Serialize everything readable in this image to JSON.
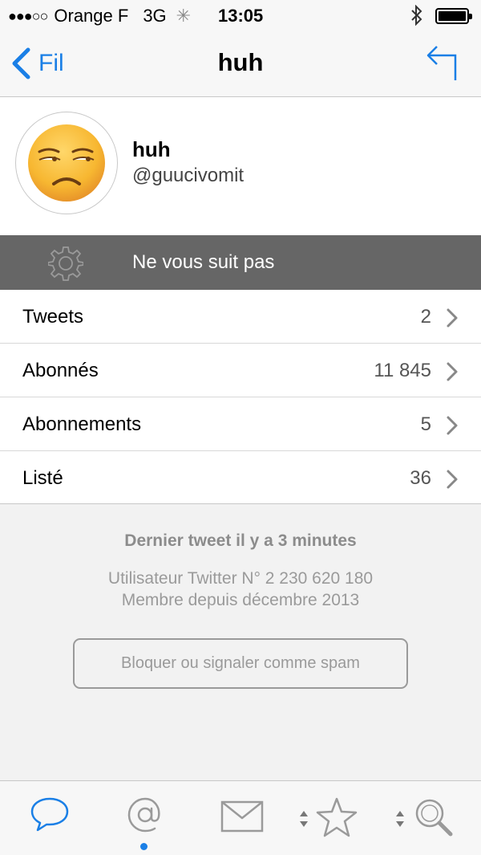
{
  "status_bar": {
    "signal": "●●●○○",
    "carrier": "Orange F",
    "network": "3G",
    "activity_icon": "spinner-icon",
    "time": "13:05",
    "bluetooth_icon": "bluetooth-icon",
    "battery_icon": "battery-icon"
  },
  "nav": {
    "back_label": "Fil",
    "title": "huh",
    "reply_icon": "reply-icon"
  },
  "profile": {
    "avatar": "unamused-face-emoji",
    "name": "huh",
    "handle": "@guucivomit"
  },
  "follow_status": {
    "icon": "gear-icon",
    "text": "Ne vous suit pas"
  },
  "stats": [
    {
      "label": "Tweets",
      "value": "2"
    },
    {
      "label": "Abonnés",
      "value": "11 845"
    },
    {
      "label": "Abonnements",
      "value": "5"
    },
    {
      "label": "Listé",
      "value": "36"
    }
  ],
  "info": {
    "last_tweet": "Dernier tweet il y a 3 minutes",
    "user_id": "Utilisateur Twitter N° 2 230 620 180",
    "member_since": "Membre depuis décembre 2013"
  },
  "block_button": "Bloquer ou signaler comme spam",
  "tabbar": {
    "tabs": [
      "chat-bubble-icon",
      "at-sign-icon",
      "envelope-icon",
      "star-icon",
      "search-icon"
    ],
    "active_indicator_under": "at-sign-icon"
  },
  "colors": {
    "accent": "#1a7fe6",
    "follow_bar": "#666666",
    "muted_text": "#9a9a9a"
  }
}
